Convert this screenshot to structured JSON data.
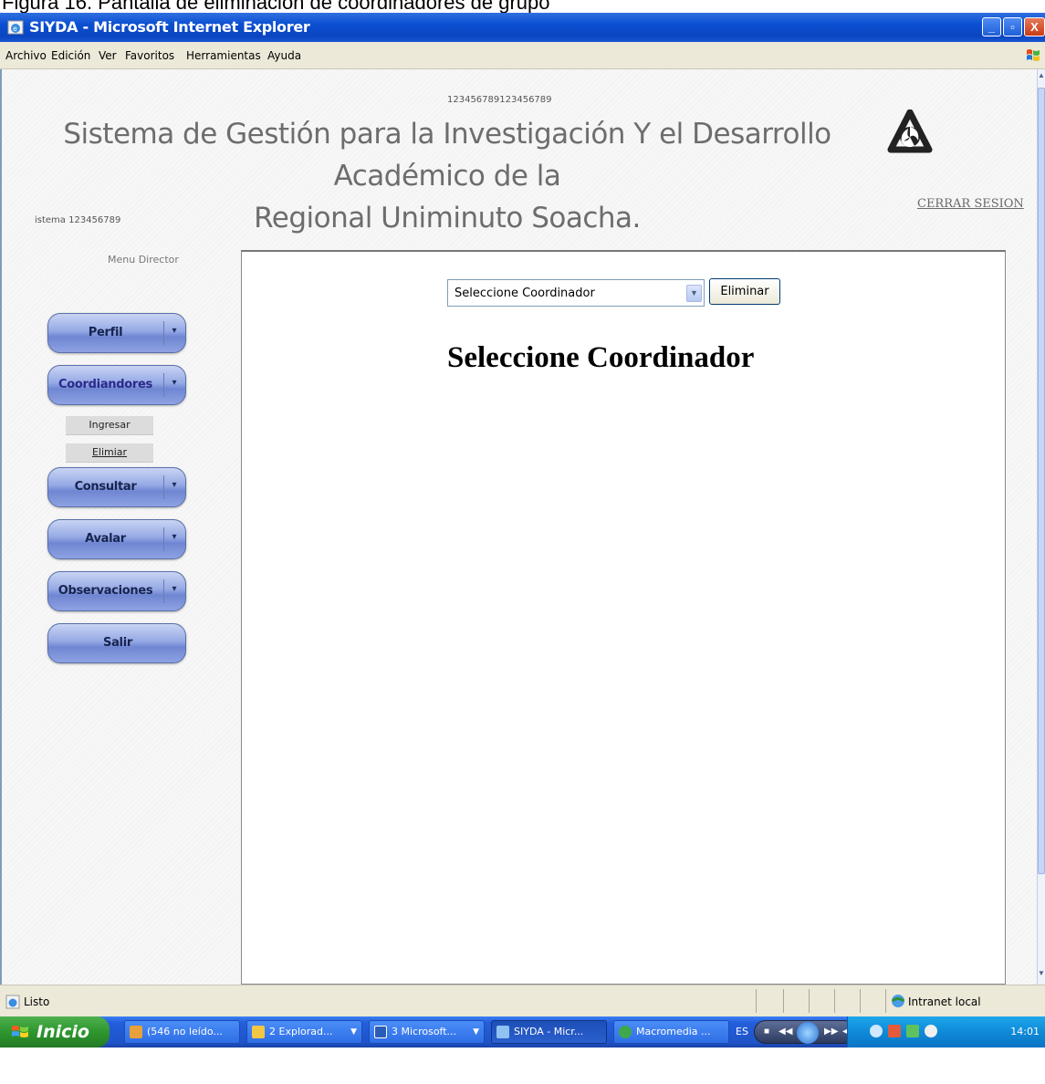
{
  "caption": "Figura 16. Pantalla de eliminación de coordinadores de grupo",
  "window": {
    "title": "SIYDA - Microsoft Internet Explorer",
    "minimize_glyph": "_",
    "maximize_glyph": "▫",
    "close_glyph": "X"
  },
  "menu": [
    "Archivo",
    "Edición",
    "Ver",
    "Favoritos",
    "Herramientas",
    "Ayuda"
  ],
  "page": {
    "counter_top": "123456789123456789",
    "title_line1": "Sistema de Gestión para la Investigación Y el Desarrollo Académico de la",
    "title_line2": "Regional Uniminuto Soacha.",
    "logout": "CERRAR SESION",
    "user_line": "istema 123456789",
    "menu_title": "Menu Director"
  },
  "nav": {
    "perfil": "Perfil",
    "coordinadores": "Coordiandores",
    "sub_ingresar": "Ingresar",
    "sub_eliminar": "Elimiar",
    "consultar": "Consultar",
    "avalar": "Avalar",
    "observaciones": "Observaciones",
    "salir": "Salir",
    "arrow": "▾"
  },
  "form": {
    "select_value": "Seleccione Coordinador",
    "delete_label": "Eliminar",
    "heading": "Seleccione Coordinador"
  },
  "status": {
    "text": "Listo",
    "zone": "Intranet local"
  },
  "taskbar": {
    "start": "Inicio",
    "tasks": [
      "(546 no leído...",
      "2 Explorad...",
      "3 Microsoft...",
      "SIYDA - Micr...",
      "Macromedia ..."
    ],
    "lang": "ES",
    "clock": "14:01"
  },
  "colors": {
    "titlebar": "#0b4fd1",
    "nav_button": "#94a8e5",
    "start_green": "#2e962e",
    "tray_blue": "#0f8ad8"
  },
  "icons": [
    "ie-icon",
    "windows-logo-icon",
    "globe-icon",
    "shield-logo-icon",
    "dropdown-arrow-icon",
    "intranet-icon",
    "windows-flag-icon"
  ]
}
